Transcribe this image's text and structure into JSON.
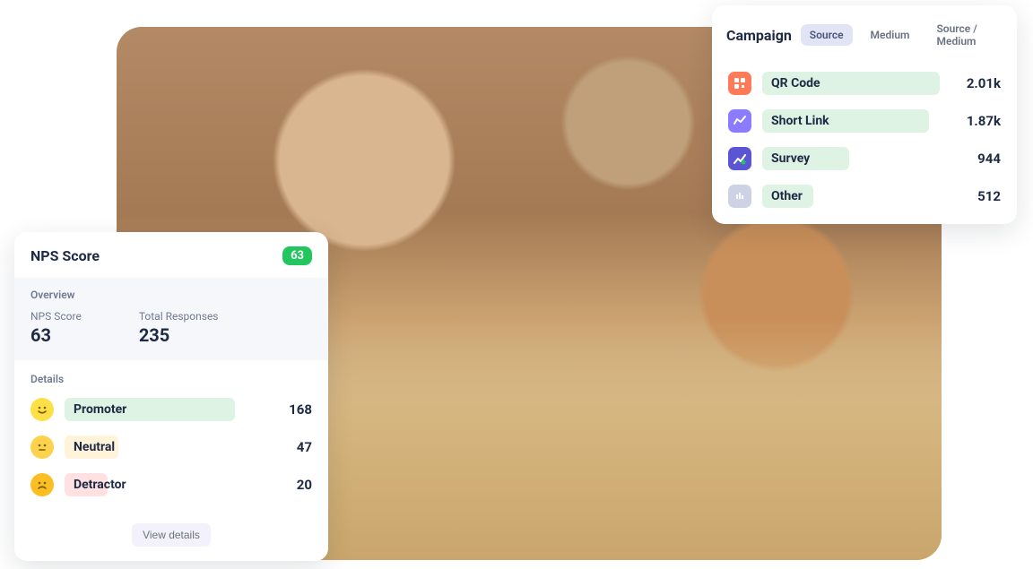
{
  "nps": {
    "title": "NPS Score",
    "badge": "63",
    "overview_label": "Overview",
    "score_label": "NPS Score",
    "score_value": "63",
    "responses_label": "Total Responses",
    "responses_value": "235",
    "details_label": "Details",
    "rows": [
      {
        "label": "Promoter",
        "value": "168",
        "bar_pct": 88
      },
      {
        "label": "Neutral",
        "value": "47",
        "bar_pct": 28
      },
      {
        "label": "Detractor",
        "value": "20",
        "bar_pct": 22
      }
    ],
    "view_details": "View details"
  },
  "campaign": {
    "title": "Campaign",
    "tabs": [
      {
        "label": "Source",
        "active": true
      },
      {
        "label": "Medium",
        "active": false
      },
      {
        "label": "Source / Medium",
        "active": false
      }
    ],
    "rows": [
      {
        "label": "QR Code",
        "value": "2.01k",
        "bar_pct": 98
      },
      {
        "label": "Short Link",
        "value": "1.87k",
        "bar_pct": 92
      },
      {
        "label": "Survey",
        "value": "944",
        "bar_pct": 48
      },
      {
        "label": "Other",
        "value": "512",
        "bar_pct": 28
      }
    ]
  },
  "chart_data": [
    {
      "type": "bar",
      "title": "NPS Score Details",
      "categories": [
        "Promoter",
        "Neutral",
        "Detractor"
      ],
      "values": [
        168,
        47,
        20
      ]
    },
    {
      "type": "bar",
      "title": "Campaign Source",
      "categories": [
        "QR Code",
        "Short Link",
        "Survey",
        "Other"
      ],
      "values": [
        2010,
        1870,
        944,
        512
      ]
    }
  ]
}
